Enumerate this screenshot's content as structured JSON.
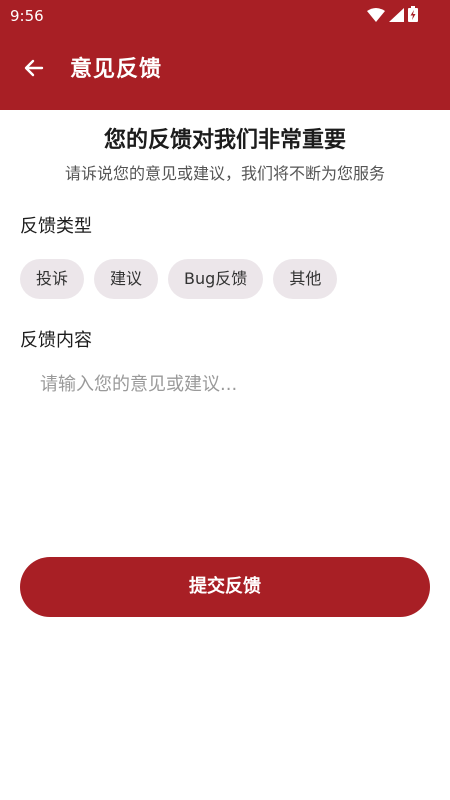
{
  "status_bar": {
    "time": "9:56",
    "icons": [
      "wifi-icon",
      "signal-icon",
      "battery-charging-icon"
    ]
  },
  "app_bar": {
    "title": "意见反馈",
    "back_icon": "arrow-left-icon"
  },
  "intro": {
    "headline": "您的反馈对我们非常重要",
    "subline": "请诉说您的意见或建议，我们将不断为您服务"
  },
  "feedback_type": {
    "label": "反馈类型",
    "options": [
      "投诉",
      "建议",
      "Bug反馈",
      "其他"
    ]
  },
  "feedback_content": {
    "label": "反馈内容",
    "value": "",
    "placeholder": "请输入您的意见或建议..."
  },
  "submit": {
    "label": "提交反馈"
  },
  "colors": {
    "brand": "#a81f25",
    "chip_bg": "#ece6ea",
    "placeholder": "#9a9a9a"
  }
}
